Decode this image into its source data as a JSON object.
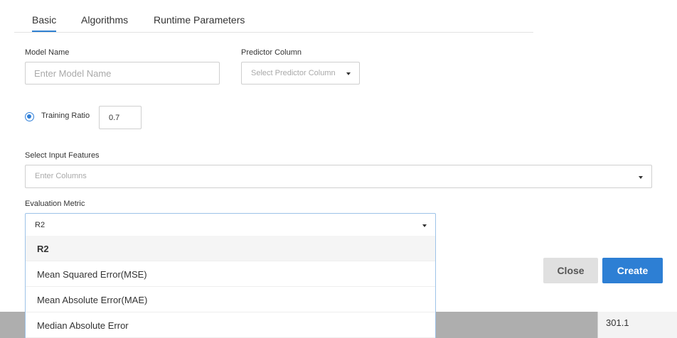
{
  "tabs": [
    "Basic",
    "Algorithms",
    "Runtime Parameters"
  ],
  "model_name": {
    "label": "Model Name",
    "placeholder": "Enter Model Name",
    "value": ""
  },
  "predictor_column": {
    "label": "Predictor Column",
    "placeholder": "Select Predictor Column"
  },
  "training_ratio": {
    "label": "Training Ratio",
    "value": "0.7",
    "selected": true
  },
  "input_features": {
    "label": "Select Input Features",
    "placeholder": "Enter Columns"
  },
  "evaluation_metric": {
    "label": "Evaluation Metric",
    "selected": "R2",
    "options": [
      "R2",
      "Mean Squared Error(MSE)",
      "Mean Absolute Error(MAE)",
      "Median Absolute Error"
    ]
  },
  "buttons": {
    "close": "Close",
    "create": "Create"
  },
  "background_table": {
    "visible_value": "301.1"
  },
  "colors": {
    "accent": "#2d7fd4",
    "close_button": "#e0e0e0",
    "overlay_row": "#aeaeae"
  }
}
